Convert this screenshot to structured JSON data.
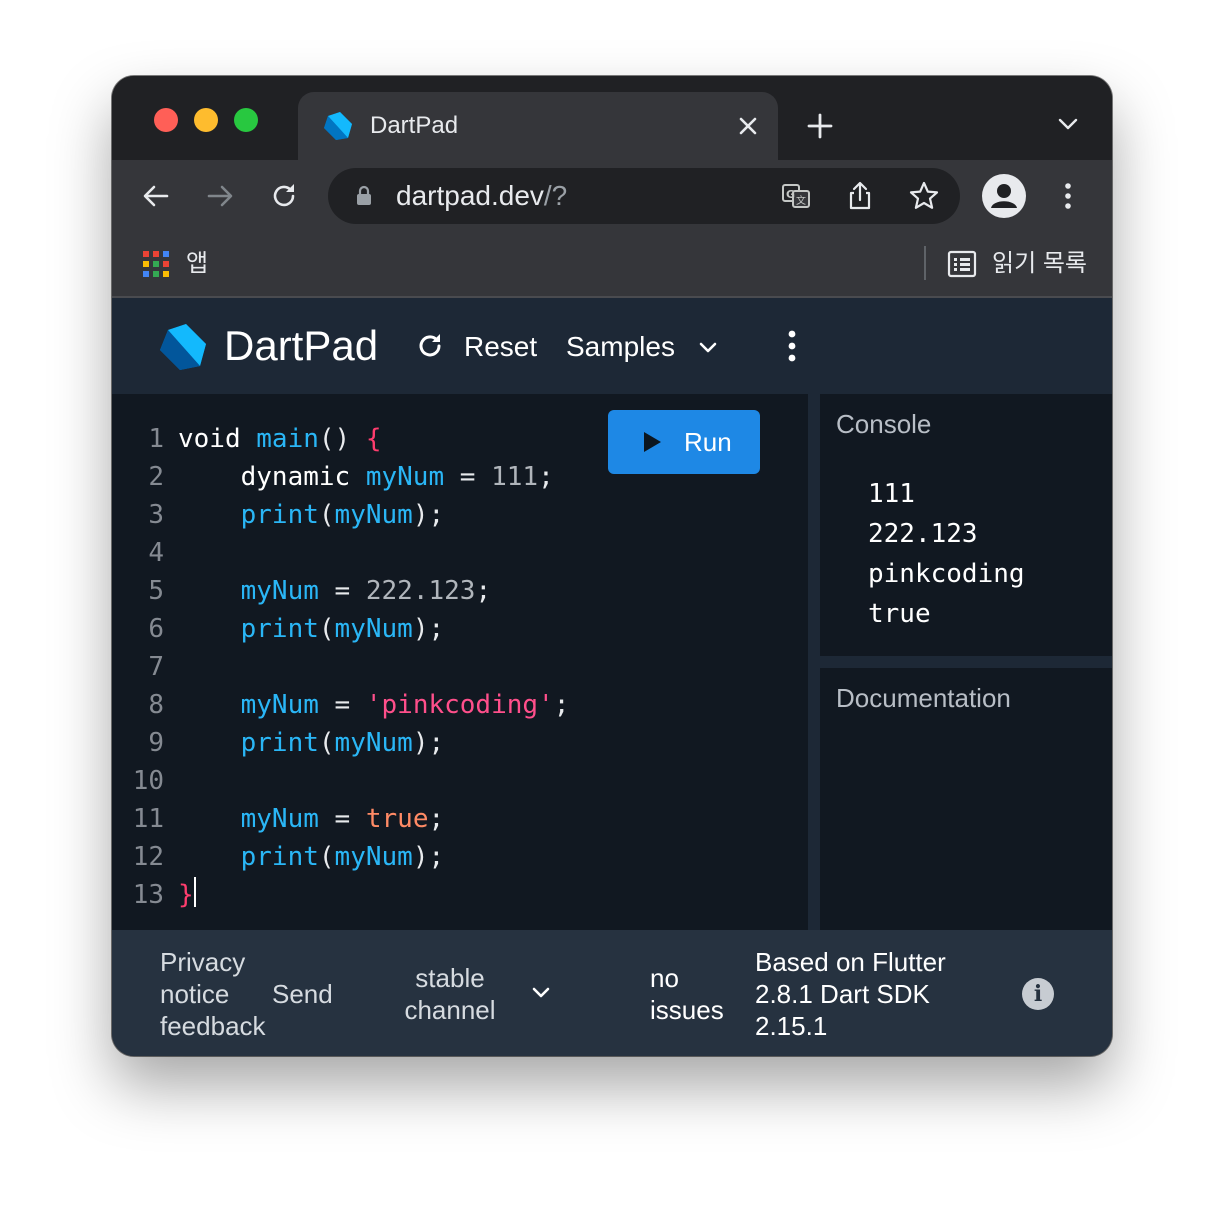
{
  "browser": {
    "tab": {
      "title": "DartPad"
    },
    "url": {
      "host": "dartpad.dev",
      "path": "/?"
    },
    "bookmarks": {
      "apps_label": "앱",
      "reading_list_label": "읽기 목록"
    }
  },
  "dartpad": {
    "title": "DartPad",
    "reset_label": "Reset",
    "samples_label": "Samples",
    "run_label": "Run",
    "line_numbers": [
      "1",
      "2",
      "3",
      "4",
      "5",
      "6",
      "7",
      "8",
      "9",
      "10",
      "11",
      "12",
      "13"
    ],
    "code": {
      "l1_kw": "void ",
      "l1_fn": "main",
      "l1_paren": "() ",
      "l1_brace": "{",
      "l2_type": "    dynamic ",
      "l2_var": "myNum",
      "l2_eq": " = ",
      "l2_val": "111",
      "l2_semi": ";",
      "l3_fn": "    print",
      "l3_open": "(",
      "l3_arg": "myNum",
      "l3_close": ");",
      "l5_var": "    myNum",
      "l5_eq": " = ",
      "l5_val": "222.123",
      "l5_semi": ";",
      "l6_fn": "    print",
      "l6_open": "(",
      "l6_arg": "myNum",
      "l6_close": ");",
      "l8_var": "    myNum",
      "l8_eq": " = ",
      "l8_val": "'pinkcoding'",
      "l8_semi": ";",
      "l9_fn": "    print",
      "l9_open": "(",
      "l9_arg": "myNum",
      "l9_close": ");",
      "l11_var": "    myNum",
      "l11_eq": " = ",
      "l11_val": "true",
      "l11_semi": ";",
      "l12_fn": "    print",
      "l12_open": "(",
      "l12_arg": "myNum",
      "l12_close": ");",
      "l13_brace": "}"
    },
    "console": {
      "title": "Console",
      "output": [
        "111",
        "222.123",
        "pinkcoding",
        "true"
      ]
    },
    "documentation": {
      "title": "Documentation"
    },
    "footer": {
      "privacy_notice": [
        "Privacy",
        "notice"
      ],
      "send_feedback": [
        "Send",
        "feedback"
      ],
      "channel": [
        "stable",
        "channel"
      ],
      "issues": [
        "no",
        "issues"
      ],
      "version": [
        "Based on Flutter",
        "2.8.1 Dart SDK",
        "2.15.1"
      ]
    }
  },
  "colors": {
    "run_button": "#1e88e5",
    "header": "#1d2836",
    "editor_bg": "#111821",
    "footer": "#263240"
  }
}
